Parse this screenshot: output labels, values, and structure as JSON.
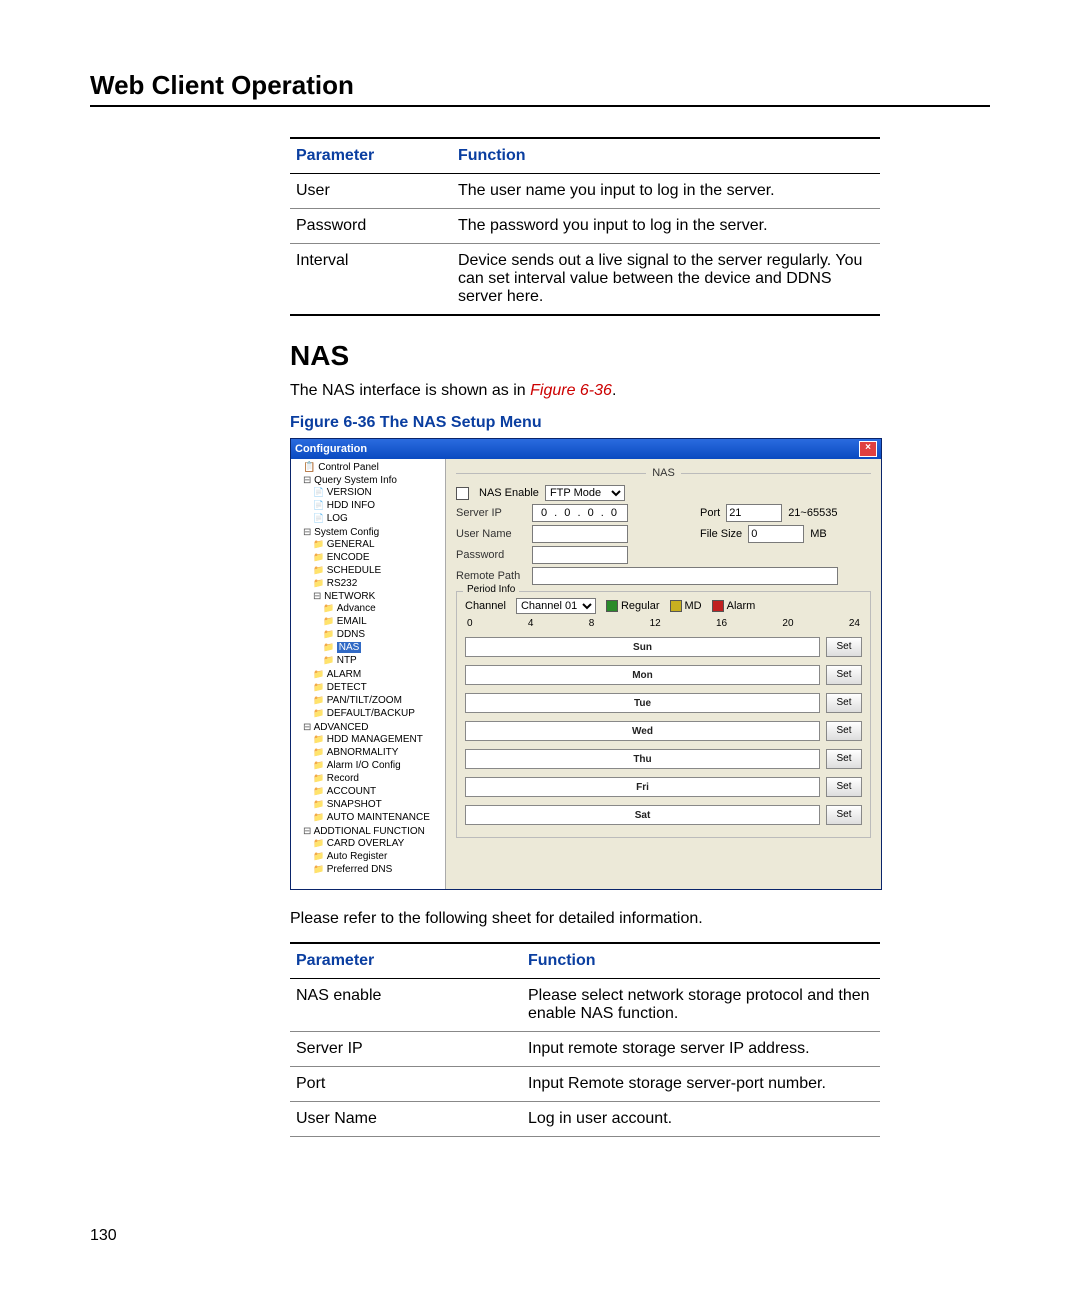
{
  "page": {
    "chapter_title": "Web Client Operation",
    "page_number": "130"
  },
  "table1": {
    "headers": {
      "param": "Parameter",
      "func": "Function"
    },
    "rows": [
      {
        "param": "User",
        "func": "The user name you input to log in the server."
      },
      {
        "param": "Password",
        "func": "The password you input to log in the server."
      },
      {
        "param": "Interval",
        "func": "Device sends out a live signal to the server regularly. You can set interval value between the device and DDNS server here."
      }
    ]
  },
  "section": {
    "heading": "NAS",
    "intro_prefix": "The NAS interface is shown as in ",
    "intro_ref": "Figure 6-36",
    "intro_suffix": ".",
    "figure_caption": "Figure 6-36 The NAS Setup Menu",
    "after_fig": "Please refer to the following sheet for detailed information."
  },
  "window": {
    "title": "Configuration",
    "tree": {
      "root": "Control Panel",
      "group1": "Query System Info",
      "g1_items": [
        "VERSION",
        "HDD INFO",
        "LOG"
      ],
      "group2": "System Config",
      "g2_items": [
        "GENERAL",
        "ENCODE",
        "SCHEDULE",
        "RS232"
      ],
      "network": "NETWORK",
      "net_items": [
        "Advance",
        "EMAIL",
        "DDNS",
        "NAS",
        "NTP"
      ],
      "g2_rest": [
        "ALARM",
        "DETECT",
        "PAN/TILT/ZOOM",
        "DEFAULT/BACKUP"
      ],
      "group3": "ADVANCED",
      "g3_items": [
        "HDD MANAGEMENT",
        "ABNORMALITY",
        "Alarm I/O Config",
        "Record",
        "ACCOUNT",
        "SNAPSHOT",
        "AUTO MAINTENANCE"
      ],
      "group4": "ADDTIONAL FUNCTION",
      "g4_items": [
        "CARD OVERLAY",
        "Auto Register",
        "Preferred DNS"
      ]
    },
    "form": {
      "header": "NAS",
      "nas_enable": "NAS Enable",
      "mode_value": "FTP Mode",
      "server_ip": "Server IP",
      "ip_value": "0 . 0 . 0 . 0",
      "port_label": "Port",
      "port_value": "21",
      "port_hint": "21~65535",
      "user_name": "User Name",
      "filesize_label": "File Size",
      "filesize_value": "0",
      "filesize_unit": "MB",
      "password": "Password",
      "remote_path": "Remote Path",
      "period_legend": "Period Info",
      "channel_label": "Channel",
      "channel_value": "Channel 01",
      "cb_regular": "Regular",
      "cb_md": "MD",
      "cb_alarm": "Alarm",
      "ticks": [
        "0",
        "4",
        "8",
        "12",
        "16",
        "20",
        "24"
      ],
      "days": [
        "Sun",
        "Mon",
        "Tue",
        "Wed",
        "Thu",
        "Fri",
        "Sat"
      ],
      "set_btn": "Set"
    }
  },
  "table2": {
    "headers": {
      "param": "Parameter",
      "func": "Function"
    },
    "rows": [
      {
        "param": "NAS enable",
        "func": "Please select network storage protocol and then enable NAS function."
      },
      {
        "param": "Server IP",
        "func": "Input remote storage server IP address."
      },
      {
        "param": "Port",
        "func": "Input Remote storage server-port number."
      },
      {
        "param": "User Name",
        "func": "Log in user account."
      }
    ]
  }
}
